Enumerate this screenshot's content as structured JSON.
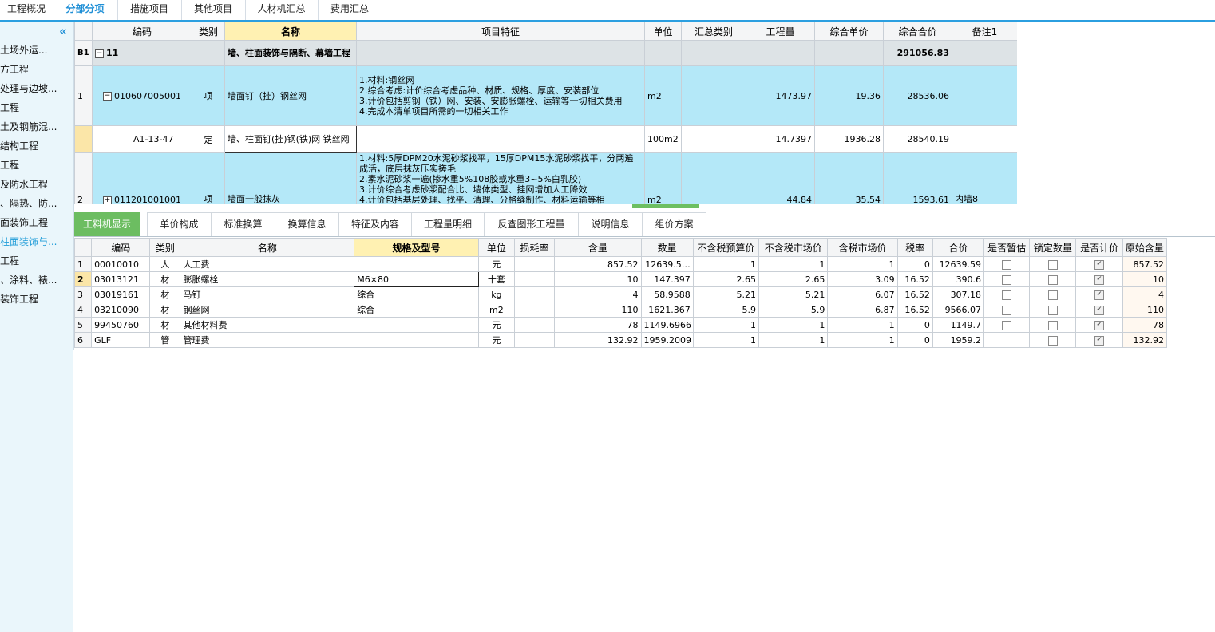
{
  "top_tabs": [
    "工程概况",
    "分部分项",
    "措施项目",
    "其他项目",
    "人材机汇总",
    "费用汇总"
  ],
  "sidebar": {
    "collapse_icon": "double-chevron-left-icon",
    "items": [
      "土场外运...",
      "方工程",
      "处理与边坡...",
      "工程",
      "土及钢筋混...",
      "结构工程",
      "工程",
      "及防水工程",
      "、隔热、防...",
      "面装饰工程",
      "柱面装饰与...",
      "工程",
      "、涂料、裱...",
      "装饰工程"
    ],
    "active_index": 10
  },
  "upper_grid": {
    "headers": [
      "",
      "编码",
      "类别",
      "名称",
      "项目特征",
      "单位",
      "汇总类别",
      "工程量",
      "综合单价",
      "综合合价",
      "备注1"
    ],
    "section": {
      "id": "B1",
      "expander": "−",
      "code": "11",
      "name": "墙、柱面装饰与隔断、幕墙工程",
      "total": "291056.83"
    },
    "rows": [
      {
        "no": "1",
        "expander": "−",
        "code": "010607005001",
        "type": "项",
        "name": "墙面钉（挂）钢丝网",
        "features": [
          "1.材料:钢丝网",
          "2.综合考虑:计价综合考虑品种、材质、规格、厚度、安装部位",
          "3.计价包括剪钢（铁）网、安装、安膨胀螺栓、运输等一切相关费用",
          "4.完成本清单项目所需的一切相关工作"
        ],
        "unit": "m2",
        "summary": "",
        "qty": "1473.97",
        "unit_price": "19.36",
        "total": "28536.06",
        "remark": ""
      },
      {
        "no": "",
        "code": "A1-13-47",
        "type": "定",
        "name": "墙、柱面钉(挂)钢(铁)网 铁丝网",
        "features": [],
        "unit": "100m2",
        "summary": "",
        "qty": "14.7397",
        "unit_price": "1936.28",
        "total": "28540.19",
        "remark": ""
      },
      {
        "no": "2",
        "expander": "+",
        "code": "011201001001",
        "type": "项",
        "name": "墙面一般抹灰",
        "features": [
          "1.材料:5厚DPM20水泥砂浆找平，15厚DPM15水泥砂浆找平，分两遍成活，底层抹灰压实搓毛",
          "2.素水泥砂浆一遍(掺水重5%108胶或水重3~5%白乳胶)",
          "3.计价综合考虑砂浆配合比、墙体类型、挂网增加人工降效",
          "4.计价包括基层处理、找平、清理、分格缝制作、材料运输等相"
        ],
        "unit": "m2",
        "summary": "",
        "qty": "44.84",
        "unit_price": "35.54",
        "total": "1593.61",
        "remark": "内墙8"
      }
    ]
  },
  "lower_tabs": [
    "工料机显示",
    "单价构成",
    "标准换算",
    "换算信息",
    "特征及内容",
    "工程量明细",
    "反查图形工程量",
    "说明信息",
    "组价方案"
  ],
  "lower_grid": {
    "headers": [
      "",
      "编码",
      "类别",
      "名称",
      "规格及型号",
      "单位",
      "损耗率",
      "含量",
      "数量",
      "不含税预算价",
      "不含税市场价",
      "含税市场价",
      "税率",
      "合价",
      "是否暂估",
      "锁定数量",
      "是否计价",
      "原始含量"
    ],
    "rows": [
      {
        "no": "1",
        "code": "00010010",
        "type": "人",
        "name": "人工费",
        "spec": "",
        "unit": "元",
        "loss": "",
        "content": "857.52",
        "qty": "12639.5…",
        "budget": "1",
        "market": "1",
        "tax_market": "1",
        "tax_rate": "0",
        "total": "12639.59",
        "estimate": false,
        "lock": false,
        "priced": true,
        "orig": "857.52"
      },
      {
        "no": "2",
        "code": "03013121",
        "type": "材",
        "name": "膨胀螺栓",
        "spec": "M6×80",
        "unit": "十套",
        "loss": "",
        "content": "10",
        "qty": "147.397",
        "budget": "2.65",
        "market": "2.65",
        "tax_market": "3.09",
        "tax_rate": "16.52",
        "total": "390.6",
        "estimate": false,
        "lock": false,
        "priced": true,
        "orig": "10"
      },
      {
        "no": "3",
        "code": "03019161",
        "type": "材",
        "name": "马钉",
        "spec": "综合",
        "unit": "kg",
        "loss": "",
        "content": "4",
        "qty": "58.9588",
        "budget": "5.21",
        "market": "5.21",
        "tax_market": "6.07",
        "tax_rate": "16.52",
        "total": "307.18",
        "estimate": false,
        "lock": false,
        "priced": true,
        "orig": "4"
      },
      {
        "no": "4",
        "code": "03210090",
        "type": "材",
        "name": "钢丝网",
        "spec": "综合",
        "unit": "m2",
        "loss": "",
        "content": "110",
        "qty": "1621.367",
        "budget": "5.9",
        "market": "5.9",
        "tax_market": "6.87",
        "tax_rate": "16.52",
        "total": "9566.07",
        "estimate": false,
        "lock": false,
        "priced": true,
        "orig": "110"
      },
      {
        "no": "5",
        "code": "99450760",
        "type": "材",
        "name": "其他材料费",
        "spec": "",
        "unit": "元",
        "loss": "",
        "content": "78",
        "qty": "1149.6966",
        "budget": "1",
        "market": "1",
        "tax_market": "1",
        "tax_rate": "0",
        "total": "1149.7",
        "estimate": false,
        "lock": false,
        "priced": true,
        "orig": "78"
      },
      {
        "no": "6",
        "code": "GLF",
        "type": "管",
        "name": "管理费",
        "spec": "",
        "unit": "元",
        "loss": "",
        "content": "132.92",
        "qty": "1959.2009",
        "budget": "1",
        "market": "1",
        "tax_market": "1",
        "tax_rate": "0",
        "total": "1959.2",
        "estimate": null,
        "lock": false,
        "priced": true,
        "orig": "132.92"
      }
    ]
  }
}
